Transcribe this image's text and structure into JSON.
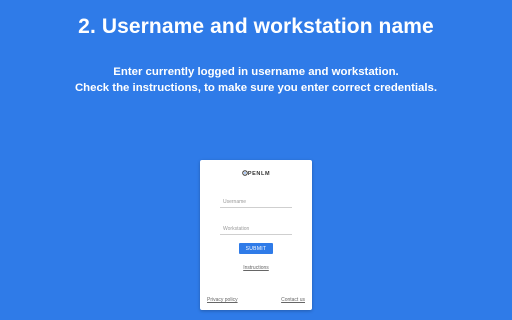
{
  "page": {
    "heading": "2.  Username and workstation name",
    "subtitle_line1": "Enter currently logged in username and workstation.",
    "subtitle_line2": "Check the instructions, to make sure you enter correct credentials."
  },
  "login_card": {
    "logo_text": "PENLM",
    "logo_icon": "openlm-logo-icon",
    "username": {
      "placeholder": "Username",
      "value": ""
    },
    "workstation": {
      "placeholder": "Workstation",
      "value": ""
    },
    "submit_label": "SUBMIT",
    "instructions_link": "Instructions",
    "privacy_link": "Privacy policy",
    "contact_link": "Contact us"
  },
  "colors": {
    "background": "#2f7be8",
    "accent": "#2f7be8",
    "card": "#ffffff"
  }
}
